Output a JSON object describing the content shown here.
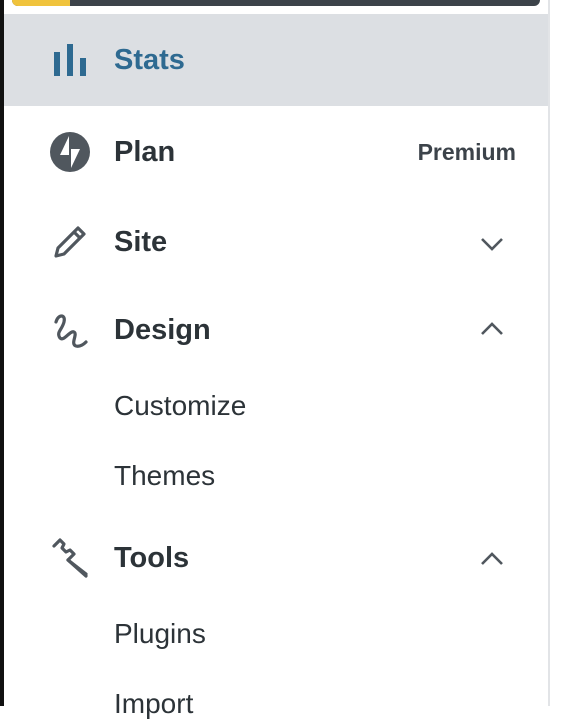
{
  "top_bar": {
    "progress_percent": 11
  },
  "sidebar": {
    "items": [
      {
        "label": "Stats",
        "icon": "stats-icon",
        "selected": true
      },
      {
        "label": "Plan",
        "icon": "jetpack-icon",
        "badge": "Premium"
      },
      {
        "label": "Site",
        "icon": "pencil-icon",
        "expanded": false
      },
      {
        "label": "Design",
        "icon": "design-icon",
        "expanded": true,
        "children": [
          "Customize",
          "Themes"
        ]
      },
      {
        "label": "Tools",
        "icon": "wrench-icon",
        "expanded": true,
        "children": [
          "Plugins",
          "Import"
        ]
      }
    ]
  },
  "colors": {
    "selected_bg": "#dcdfe3",
    "selected_text": "#2e6a91",
    "text": "#2c3338",
    "icon": "#50575e",
    "accent": "#f0c33c"
  }
}
